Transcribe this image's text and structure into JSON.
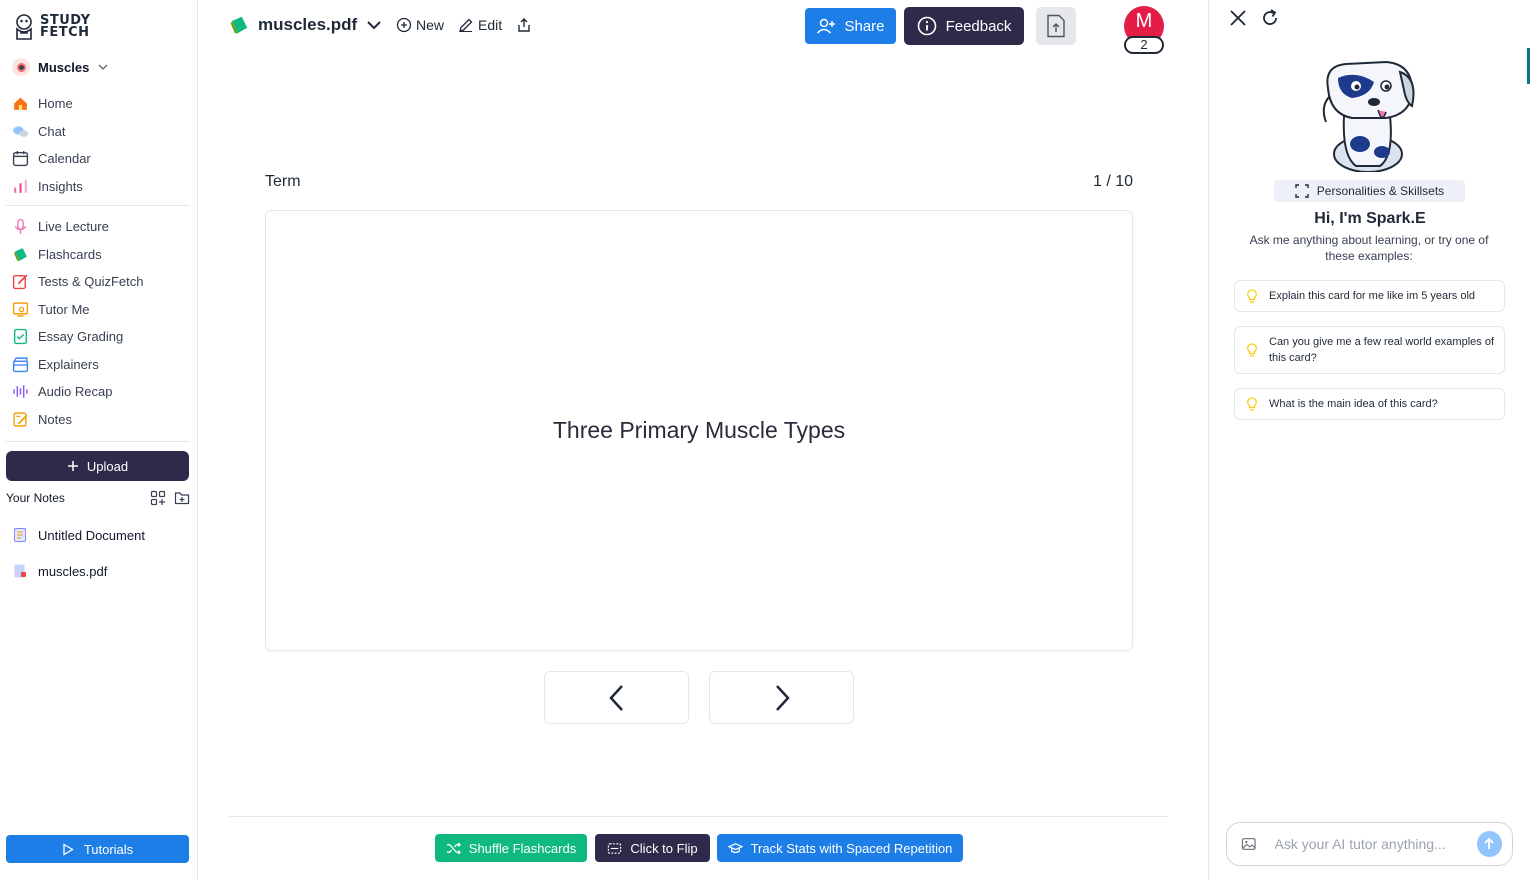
{
  "brand": {
    "line1": "STUDY",
    "line2": "FETCH"
  },
  "workspace": {
    "name": "Muscles"
  },
  "nav_primary": [
    {
      "label": "Home",
      "icon": "home-icon"
    },
    {
      "label": "Chat",
      "icon": "chat-icon"
    },
    {
      "label": "Calendar",
      "icon": "calendar-icon"
    },
    {
      "label": "Insights",
      "icon": "insights-icon"
    }
  ],
  "nav_tools": [
    {
      "label": "Live Lecture",
      "icon": "microphone-icon"
    },
    {
      "label": "Flashcards",
      "icon": "flashcards-icon"
    },
    {
      "label": "Tests & QuizFetch",
      "icon": "test-icon"
    },
    {
      "label": "Tutor Me",
      "icon": "tutor-icon"
    },
    {
      "label": "Essay Grading",
      "icon": "essay-icon"
    },
    {
      "label": "Explainers",
      "icon": "explainers-icon"
    },
    {
      "label": "Audio Recap",
      "icon": "audio-icon"
    },
    {
      "label": "Notes",
      "icon": "notes-icon"
    }
  ],
  "upload": {
    "label": "Upload"
  },
  "your_notes": {
    "title": "Your Notes"
  },
  "notes": [
    {
      "label": "Untitled Document",
      "icon": "document-icon"
    },
    {
      "label": "muscles.pdf",
      "icon": "pdf-icon"
    }
  ],
  "tutorials": {
    "label": "Tutorials"
  },
  "topbar": {
    "file_name": "muscles.pdf",
    "new_label": "New",
    "edit_label": "Edit",
    "share_label": "Share",
    "feedback_label": "Feedback",
    "avatar_initial": "M",
    "avatar_badge": "2"
  },
  "flashcard": {
    "side_label": "Term",
    "counter": "1 / 10",
    "text": "Three Primary Muscle Types"
  },
  "bottom_actions": {
    "shuffle": "Shuffle Flashcards",
    "flip": "Click to Flip",
    "track": "Track Stats with Spaced Repetition"
  },
  "assistant": {
    "personalities_label": "Personalities & Skillsets",
    "greeting": "Hi, I'm Spark.E",
    "description": "Ask me anything about learning, or try one of these examples:",
    "suggestions": [
      "Explain this card for me like im 5 years old",
      "Can you give me a few real world examples of this card?",
      "What is the main idea of this card?"
    ],
    "input_placeholder": "Ask your AI tutor anything..."
  },
  "colors": {
    "primary_blue": "#1d7ee8",
    "dark_navy": "#2f2a4a",
    "shuffle_green": "#10b981",
    "avatar_red": "#e11d48"
  }
}
